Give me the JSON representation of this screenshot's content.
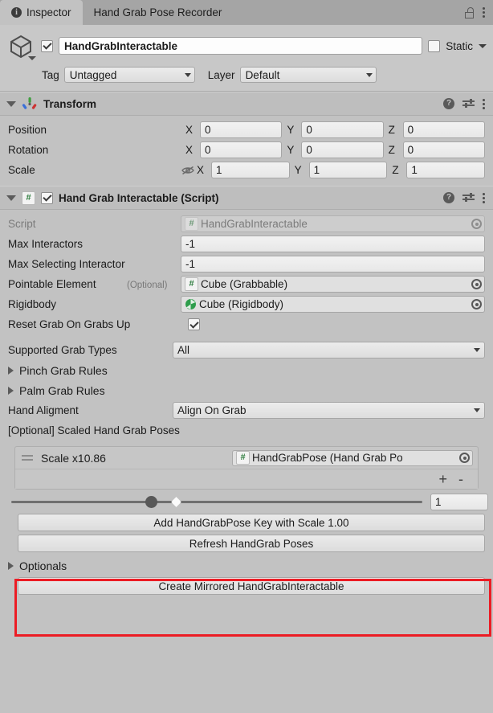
{
  "tabs": [
    {
      "label": "Inspector",
      "icon": "info-icon",
      "active": true
    },
    {
      "label": "Hand Grab Pose Recorder",
      "icon": "",
      "active": false
    }
  ],
  "window_controls": {
    "lock": "lock-open-icon",
    "menu": "kebab-menu-icon"
  },
  "gameobject": {
    "icon": "cube-icon",
    "enabled": true,
    "name": "HandGrabInteractable",
    "static_label": "Static",
    "static_checked": false,
    "tag_label": "Tag",
    "tag_value": "Untagged",
    "layer_label": "Layer",
    "layer_value": "Default"
  },
  "transform": {
    "title": "Transform",
    "expanded": true,
    "rows": [
      {
        "label": "Position",
        "x": "0",
        "y": "0",
        "z": "0",
        "extra_icon": ""
      },
      {
        "label": "Rotation",
        "x": "0",
        "y": "0",
        "z": "0",
        "extra_icon": ""
      },
      {
        "label": "Scale",
        "x": "1",
        "y": "1",
        "z": "1",
        "extra_icon": "constrain-proportions-off-icon"
      }
    ],
    "axis_labels": {
      "x": "X",
      "y": "Y",
      "z": "Z"
    }
  },
  "component": {
    "title": "Hand Grab Interactable (Script)",
    "enabled": true,
    "expanded": true,
    "script_label": "Script",
    "script_value": "HandGrabInteractable",
    "fields": {
      "max_interactors_label": "Max Interactors",
      "max_interactors_value": "-1",
      "max_selecting_label": "Max Selecting Interactor",
      "max_selecting_value": "-1",
      "pointable_label": "Pointable Element",
      "pointable_optional": "(Optional)",
      "pointable_value": "Cube (Grabbable)",
      "rigidbody_label": "Rigidbody",
      "rigidbody_value": "Cube (Rigidbody)",
      "reset_grab_label": "Reset Grab On Grabs Up",
      "reset_grab_checked": true,
      "supported_types_label": "Supported Grab Types",
      "supported_types_value": "All",
      "pinch_rules_label": "Pinch Grab Rules",
      "palm_rules_label": "Palm Grab Rules",
      "hand_alignment_label": "Hand Aligment",
      "hand_alignment_value": "Align On Grab",
      "scaled_poses_label": "[Optional] Scaled Hand Grab Poses"
    },
    "pose_list": {
      "items": [
        {
          "handle": "drag-handle-icon",
          "label": "Scale x10.86",
          "object_value": "HandGrabPose (Hand Grab Po"
        }
      ],
      "add_button": "+",
      "remove_button": "-"
    },
    "slider": {
      "value": "1",
      "knob_percent": 34,
      "marker_percent": 40
    },
    "buttons": {
      "add_key": "Add HandGrabPose Key with Scale 1.00",
      "refresh": "Refresh HandGrab Poses",
      "create_mirrored": "Create Mirrored HandGrabInteractable"
    },
    "optionals_label": "Optionals"
  },
  "highlight": {
    "color": "#ec1c24"
  }
}
